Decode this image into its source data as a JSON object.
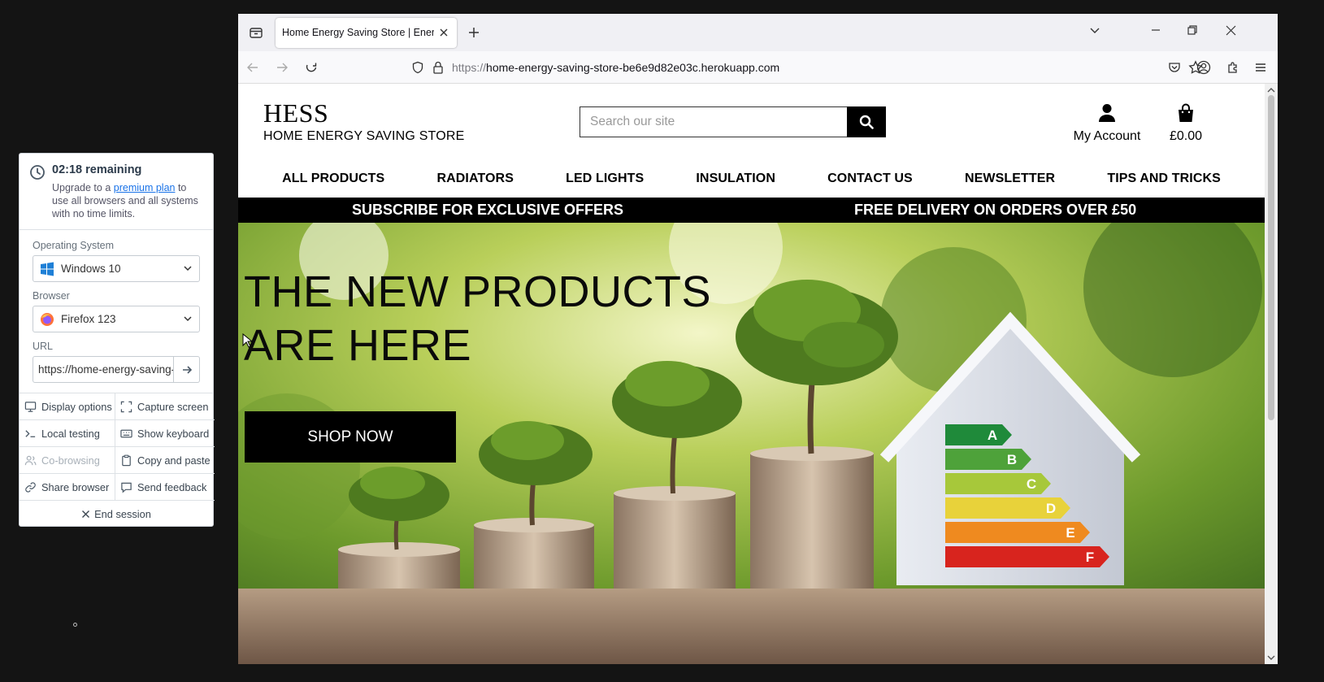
{
  "session": {
    "timer": "02:18 remaining",
    "upgrade_pre": "Upgrade to a ",
    "upgrade_link": "premium plan",
    "upgrade_post": " to use all browsers and all systems with no time limits.",
    "os_label": "Operating System",
    "os_value": "Windows 10",
    "browser_label": "Browser",
    "browser_value": "Firefox 123",
    "url_label": "URL",
    "url_value": "https://home-energy-saving-store-be6e9d82e03c.herokuapp.com",
    "actions": {
      "display_options": "Display options",
      "capture_screen": "Capture screen",
      "local_testing": "Local testing",
      "show_keyboard": "Show keyboard",
      "co_browsing": "Co-browsing",
      "copy_paste": "Copy and paste",
      "share_browser": "Share browser",
      "send_feedback": "Send feedback",
      "end_session": "End session"
    }
  },
  "browser": {
    "tab_title": "Home Energy Saving Store | Energy",
    "url_scheme": "https://",
    "url_host": "home-energy-saving-store-be6e9d82e03c.herokuapp.com"
  },
  "site": {
    "brand_short": "HESS",
    "brand_long": "HOME ENERGY SAVING STORE",
    "search_placeholder": "Search our site",
    "account_label": "My Account",
    "cart_total": "£0.00",
    "nav": [
      "ALL PRODUCTS",
      "RADIATORS",
      "LED LIGHTS",
      "INSULATION",
      "CONTACT US",
      "NEWSLETTER",
      "TIPS AND TRICKS"
    ],
    "banner_left": "SUBSCRIBE FOR EXCLUSIVE OFFERS",
    "banner_right": "FREE DELIVERY ON ORDERS OVER £50",
    "hero_line1": "THE NEW PRODUCTS",
    "hero_line2": "ARE HERE",
    "hero_button": "SHOP NOW",
    "energy_ratings": [
      "A",
      "B",
      "C",
      "D",
      "E",
      "F"
    ]
  }
}
